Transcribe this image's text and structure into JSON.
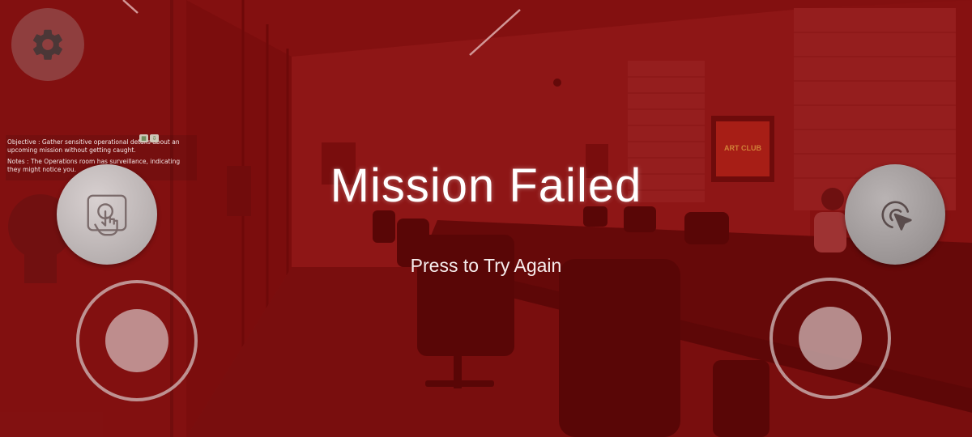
{
  "objective": {
    "text": "Objective : Gather sensitive operational details about an upcoming mission without getting caught.",
    "notes": "Notes : The Operations room has surveillance, indicating they might notice you."
  },
  "poster": {
    "text": "ART CLUB"
  },
  "overlay": {
    "title": "Mission Failed",
    "retry_label": "Press to Try Again",
    "tint_color": "#a01414"
  },
  "icons": {
    "settings": "gear-icon",
    "tap": "tap-hand-icon",
    "aim": "cursor-target-icon"
  }
}
